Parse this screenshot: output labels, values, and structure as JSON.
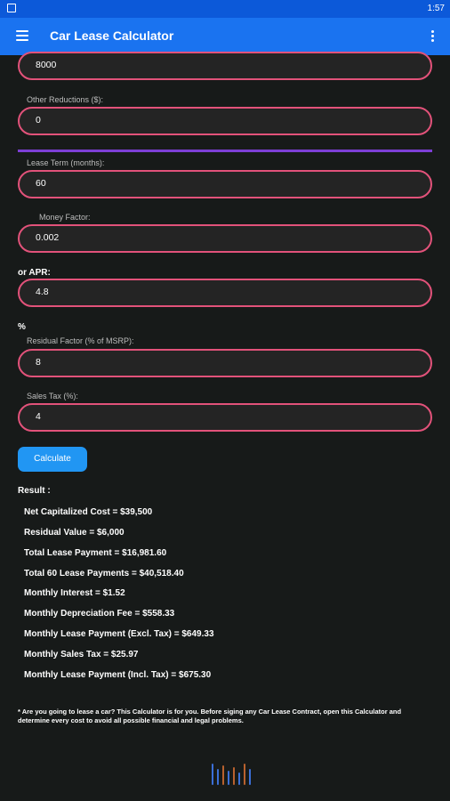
{
  "status": {
    "time": "1:57"
  },
  "appbar": {
    "title": "Car Lease Calculator",
    "menu_icon": "hamburger-icon",
    "more_icon": "more-vert-icon"
  },
  "form": {
    "top_value": "8000",
    "other_reductions": {
      "label": "Other Reductions ($):",
      "value": "0"
    },
    "lease_term": {
      "label": "Lease Term (months):",
      "value": "60"
    },
    "money_factor": {
      "label": "Money Factor:",
      "value": "0.002"
    },
    "apr": {
      "label": "or APR:",
      "value": "4.8"
    },
    "percent_sign": "%",
    "residual_factor": {
      "label": "Residual Factor (% of MSRP):",
      "value": "8"
    },
    "sales_tax": {
      "label": "Sales Tax (%):",
      "value": "4"
    },
    "calculate_label": "Calculate"
  },
  "result": {
    "title": "Result :",
    "lines": [
      "Net Capitalized Cost = $39,500",
      "Residual Value = $6,000",
      "Total Lease Payment = $16,981.60",
      "Total 60 Lease Payments = $40,518.40",
      "Monthly Interest = $1.52",
      "Monthly Depreciation Fee = $558.33",
      "Monthly Lease Payment (Excl. Tax) = $649.33",
      "Monthly Sales Tax = $25.97",
      "Monthly Lease Payment (Incl. Tax) = $675.30"
    ]
  },
  "footnote": "* Are you going to lease a car? This Calculator is for you. Before siging any Car Lease Contract, open this Calculator and determine every cost to avoid all possible financial and legal problems.",
  "colors": {
    "statusbar": "#0c59d9",
    "appbar": "#1a73f0",
    "field_border": "#e2527a",
    "divider": "#7d3fd6",
    "button": "#2196f3"
  }
}
